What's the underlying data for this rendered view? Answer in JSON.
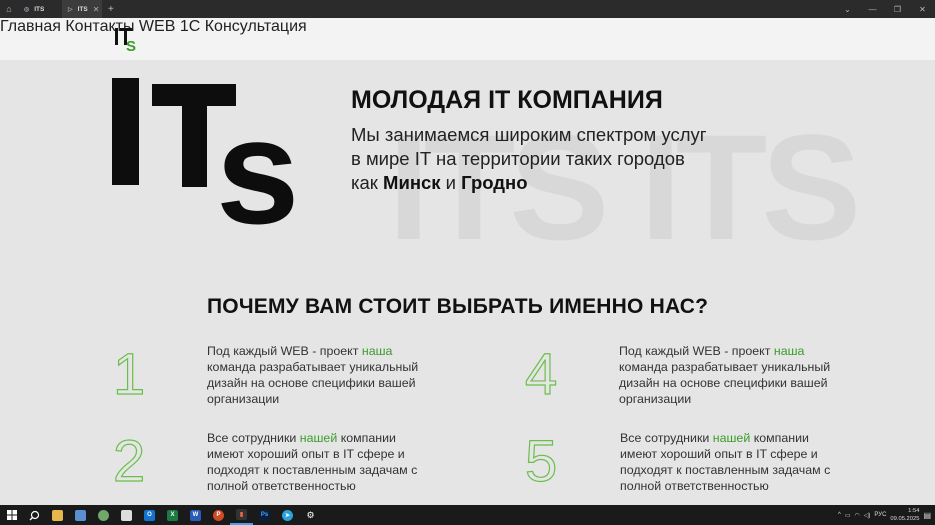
{
  "browser": {
    "tabs": [
      {
        "label": "ITS",
        "active": false
      },
      {
        "label": "ITS",
        "active": true
      }
    ],
    "new_tab": "+",
    "controls": [
      "⌄",
      "—",
      "❐",
      "✕"
    ]
  },
  "header": {
    "nav": [
      "Главная",
      "Контакты",
      "WEB",
      "1C"
    ],
    "cta": "Консультация"
  },
  "hero": {
    "title": "МОЛОДАЯ IT КОМПАНИЯ",
    "line1": "Мы занимаемся широким спектром услуг",
    "line2": "в мире IT на территории таких городов",
    "line3_pre": "как ",
    "city1": "Минск",
    "line3_mid": " и ",
    "city2": "Гродно",
    "watermark1": "ITS",
    "watermark2": "ITS"
  },
  "why": {
    "title": "ПОЧЕМУ ВАМ СТОИТ ВЫБРАТЬ ИМЕННО НАС?",
    "items": [
      {
        "num": "1",
        "pre": "Под каждый WEB - проект ",
        "hl": "наша",
        "post": " команда разрабатывает уникальный дизайн на основе специфики вашей организации"
      },
      {
        "num": "2",
        "pre": "Все сотрудники ",
        "hl": "нашей",
        "post": " компании имеют хороший опыт в IT сфере и подходят к поставленным задачам с полной ответственностью"
      },
      {
        "num": "4",
        "pre": "Под каждый WEB - проект ",
        "hl": "наша",
        "post": " команда разрабатывает уникальный дизайн на основе специфики вашей организации"
      },
      {
        "num": "5",
        "pre": "Все сотрудники ",
        "hl": "нашей",
        "post": " компании имеют хороший опыт в IT сфере и подходят к поставленным задачам с полной ответственностью"
      }
    ]
  },
  "taskbar": {
    "lang": "РУС",
    "time": "1:54",
    "date": "09.05.2025"
  },
  "colors": {
    "accent_green": "#3a9c2a",
    "page_bg": "#e5e5e5",
    "header_bg": "#f3f3f3"
  }
}
